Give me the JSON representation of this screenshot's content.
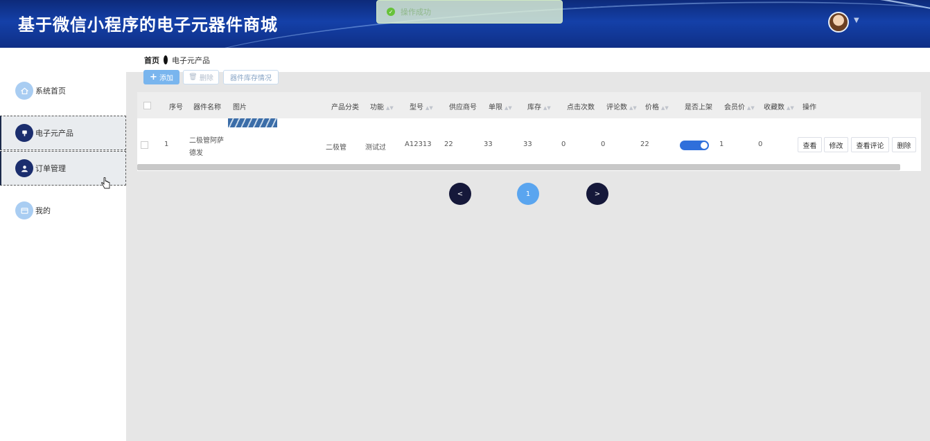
{
  "header": {
    "title": "基于微信小程序的电子元器件商城"
  },
  "toast": {
    "text": "操作成功"
  },
  "sidebar": {
    "items": [
      {
        "label": "系统首页",
        "icon": "home-icon"
      },
      {
        "label": "电子元产品",
        "icon": "product-icon"
      },
      {
        "label": "订单管理",
        "icon": "user-icon"
      },
      {
        "label": "我的",
        "icon": "card-icon"
      }
    ]
  },
  "breadcrumb": {
    "home": "首页",
    "current": "电子元产品"
  },
  "toolbar": {
    "add": "添加",
    "delete": "删除",
    "stock": "器件库存情况"
  },
  "table": {
    "columns": [
      "序号",
      "器件名称",
      "图片",
      "产品分类",
      "功能",
      "型号",
      "供应商号",
      "单限",
      "库存",
      "点击次数",
      "评论数",
      "价格",
      "是否上架",
      "会员价",
      "收藏数",
      "操作"
    ],
    "rows": [
      {
        "index": "1",
        "name_line1": "二极管阿萨",
        "name_line2": "德发",
        "category": "二极管",
        "function": "测试过",
        "model": "A12313",
        "supplier": "22",
        "limit": "33",
        "stock": "33",
        "clicks": "0",
        "comments": "0",
        "price": "22",
        "listed": true,
        "member_price": "1",
        "favorites": "0"
      }
    ],
    "actions": [
      "查看",
      "修改",
      "查看评论",
      "删除"
    ]
  },
  "pagination": {
    "prev": "<",
    "current": "1",
    "next": ">"
  }
}
